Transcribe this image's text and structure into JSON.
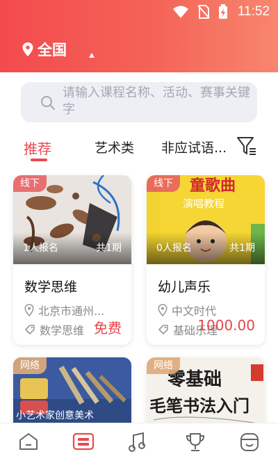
{
  "status_bar": {
    "time": "11:52"
  },
  "location": {
    "label": "全国"
  },
  "search": {
    "placeholder": "请输入课程名称、活动、赛事关键字"
  },
  "tabs": [
    {
      "label": "推荐",
      "active": true
    },
    {
      "label": "艺术类",
      "active": false
    },
    {
      "label": "非应试语..."
    }
  ],
  "cards": [
    {
      "badge": "线下",
      "registered": "1人报名",
      "periods": "共1期",
      "title": "数学思维",
      "address": "北京市通州...",
      "category": "数学思维",
      "price": "免费"
    },
    {
      "badge": "线下",
      "registered": "0人报名",
      "periods": "共1期",
      "title": "幼儿声乐",
      "address": "中文时代",
      "category": "基础乐理",
      "price": "1000.00",
      "image_text": {
        "top": "童歌曲",
        "middle": "演唱教程"
      }
    },
    {
      "badge": "网络",
      "image_text": "小艺术家创意美术"
    },
    {
      "badge": "网络",
      "image_text": {
        "line1": "零基础",
        "line2": "毛笔书法入门"
      }
    }
  ],
  "bottom_nav": [
    "home-icon",
    "courses-icon",
    "music-icon",
    "trophy-icon",
    "profile-icon"
  ],
  "colors": {
    "brand": "#e84a50",
    "header_start": "#f44a4e",
    "header_end": "#f8866e",
    "price": "#e6444a"
  }
}
